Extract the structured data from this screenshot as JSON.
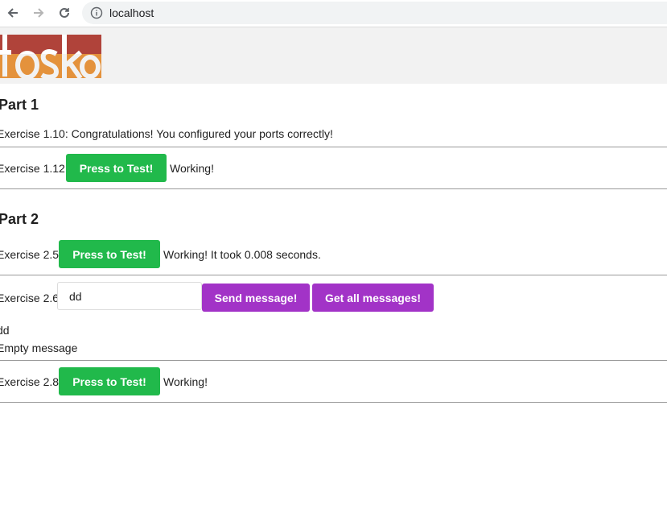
{
  "browser": {
    "url": "localhost"
  },
  "logo": {
    "text": "toska",
    "colors": {
      "top": "#b0433a",
      "bottom": "#e4923c"
    }
  },
  "part1": {
    "title": "Part 1",
    "ex110": {
      "text": "Exercise 1.10: Congratulations! You configured your ports correctly!"
    },
    "ex112": {
      "label": "Exercise 1.12:",
      "button": "Press to Test!",
      "status": "Working!"
    }
  },
  "part2": {
    "title": "Part 2",
    "ex25": {
      "label": "Exercise 2.5:",
      "button": "Press to Test!",
      "status": "Working! It took 0.008 seconds."
    },
    "ex26": {
      "label": "Exercise 2.6:",
      "input_value": "dd",
      "send_button": "Send message!",
      "get_button": "Get all messages!",
      "messages": [
        "dd",
        "Empty message"
      ]
    },
    "ex28": {
      "label": "Exercise 2.8:",
      "button": "Press to Test!",
      "status": "Working!"
    }
  },
  "colors": {
    "green_button": "#21b94b",
    "purple_button": "#a233c7"
  }
}
